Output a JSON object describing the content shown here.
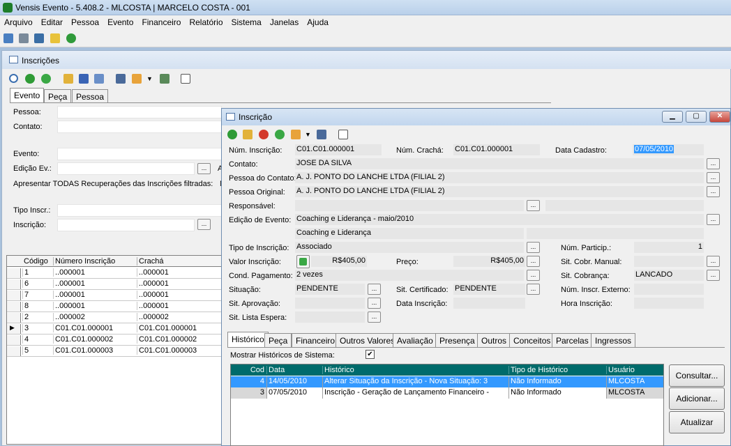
{
  "app": {
    "title": "Vensis Evento - 5.408.2 - MLCOSTA | MARCELO COSTA - 001",
    "menu": [
      "Arquivo",
      "Editar",
      "Pessoa",
      "Evento",
      "Financeiro",
      "Relatório",
      "Sistema",
      "Janelas",
      "Ajuda"
    ]
  },
  "inscricoes": {
    "title": "Inscrições",
    "tabs": [
      "Evento",
      "Peça",
      "Pessoa"
    ],
    "labels": {
      "pessoa": "Pessoa:",
      "contato": "Contato:",
      "evento": "Evento:",
      "edicao": "Edição Ev.:",
      "apresentar": "Apresentar TODAS Recuperações das Inscrições filtradas:",
      "tipo": "Tipo Inscr.:",
      "inscricao": "Inscrição:"
    },
    "truncated": {
      "a1": "A",
      "n1": "N"
    },
    "grid": {
      "columns": [
        "Código",
        "Número Inscrição",
        "Crachá"
      ],
      "rows": [
        [
          "1",
          "..000001",
          "..000001"
        ],
        [
          "6",
          "..000001",
          "..000001"
        ],
        [
          "7",
          "..000001",
          "..000001"
        ],
        [
          "8",
          "..000001",
          "..000001"
        ],
        [
          "2",
          "..000002",
          "..000002"
        ],
        [
          "3",
          "C01.C01.000001",
          "C01.C01.000001"
        ],
        [
          "4",
          "C01.C01.000002",
          "C01.C01.000002"
        ],
        [
          "5",
          "C01.C01.000003",
          "C01.C01.000003"
        ]
      ],
      "current_row_index": 5
    }
  },
  "inscricao": {
    "title": "Inscrição",
    "labels": {
      "num_inscricao": "Núm. Inscrição:",
      "num_cracha": "Núm. Crachá:",
      "data_cadastro": "Data Cadastro:",
      "contato": "Contato:",
      "pessoa_contato": "Pessoa do Contato:",
      "pessoa_original": "Pessoa Original:",
      "responsavel": "Responsável:",
      "edicao_evento": "Edição de Evento:",
      "tipo_inscricao": "Tipo de Inscrição:",
      "valor_inscricao": "Valor Inscrição:",
      "cond_pagamento": "Cond. Pagamento:",
      "situacao": "Situação:",
      "sit_aprovacao": "Sit. Aprovação:",
      "sit_lista_espera": "Sit. Lista Espera:",
      "preco": "Preço:",
      "sit_certificado": "Sit. Certificado:",
      "data_inscricao": "Data Inscrição:",
      "num_particip": "Núm. Particip.:",
      "sit_cobr_manual": "Sit. Cobr. Manual:",
      "sit_cobranca": "Sit. Cobrança:",
      "num_inscr_externo": "Núm. Inscr. Externo:",
      "hora_inscricao": "Hora Inscrição:"
    },
    "values": {
      "num_inscricao": "C01.C01.000001",
      "num_cracha": "C01.C01.000001",
      "data_cadastro": "07/05/2010",
      "contato": "JOSE DA SILVA",
      "pessoa_contato": "A. J. PONTO DO LANCHE LTDA (FILIAL 2)",
      "pessoa_original": "A. J. PONTO DO LANCHE LTDA (FILIAL 2)",
      "edicao_evento": "Coaching e Liderança - maio/2010",
      "evento": "Coaching e Liderança",
      "tipo_inscricao": "Associado",
      "valor_inscricao": "R$405,00",
      "preco": "R$405,00",
      "cond_pagamento": "2 vezes",
      "situacao": "PENDENTE",
      "sit_certificado": "PENDENTE",
      "num_particip": "1",
      "sit_cobranca": "LANCADO"
    },
    "ellipsis": "...",
    "tabs": [
      "Histórico",
      "Peça",
      "Financeiro",
      "Outros Valores",
      "Avaliação",
      "Presença",
      "Outros",
      "Conceitos",
      "Parcelas",
      "Ingressos"
    ],
    "mostrar_historicos": "Mostrar Históricos de Sistema:",
    "checkmark": "✔",
    "hist": {
      "columns": [
        "Cod",
        "Data",
        "Histórico",
        "Tipo de Histórico",
        "Usuário"
      ],
      "rows": [
        [
          "4",
          "14/05/2010",
          "Alterar Situação da Inscrição - Nova Situação: 3",
          "Não Informado",
          "MLCOSTA"
        ],
        [
          "3",
          "07/05/2010",
          "Inscrição - Geração de Lançamento Financeiro -",
          "Não Informado",
          "MLCOSTA"
        ]
      ]
    },
    "buttons": {
      "consultar": "Consultar...",
      "adicionar": "Adicionar...",
      "atualizar": "Atualizar"
    }
  },
  "colors": {
    "grid_header": "#006b6b",
    "selected_row": "#3399ff",
    "window_frame": "#b9d0ea"
  }
}
